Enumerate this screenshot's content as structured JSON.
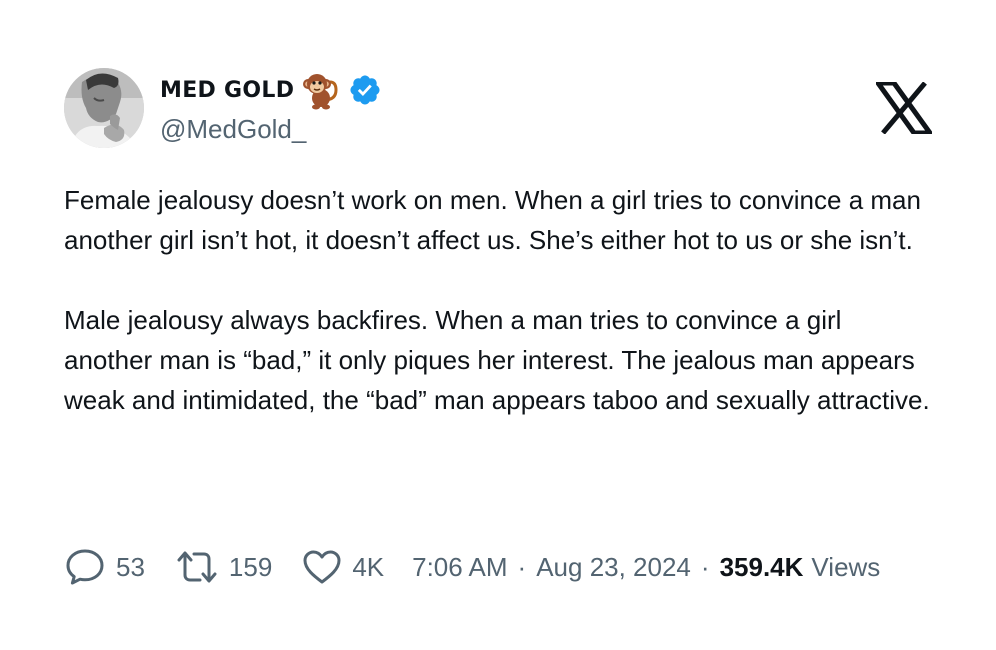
{
  "author": {
    "display_name": "MED GOLD",
    "handle": "@MedGold_",
    "avatar_icon": "profile-photo",
    "name_emoji_icon": "monkey-emoji-icon",
    "verified_icon": "verified-badge-icon",
    "verified_color": "#1d9bf0"
  },
  "brand": {
    "logo_icon": "x-logo-icon"
  },
  "tweet": {
    "paragraphs": [
      "Female jealousy doesn’t work on men. When a girl tries to convince a man another girl isn’t hot, it doesn’t affect us. She’s either hot to us or she isn’t.",
      "Male jealousy always backfires. When a man tries to convince a girl another man is “bad,” it only piques her interest. The jealous man appears weak and intimidated, the “bad” man appears taboo and sexually attractive."
    ]
  },
  "stats": {
    "replies": "53",
    "reposts": "159",
    "likes": "4K",
    "time": "7:06 AM",
    "date": "Aug 23, 2024",
    "separator": "·",
    "views_count": "359.4K",
    "views_label": "Views"
  },
  "colors": {
    "text_primary": "#0f1419",
    "text_secondary": "#536471",
    "background": "#ffffff"
  }
}
